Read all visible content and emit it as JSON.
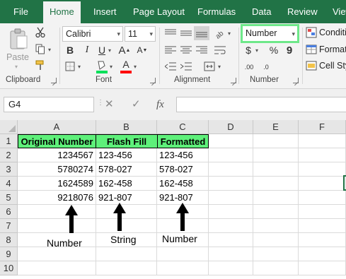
{
  "tabs": [
    {
      "label": "File",
      "active": false
    },
    {
      "label": "Home",
      "active": true
    },
    {
      "label": "Insert",
      "active": false
    },
    {
      "label": "Page Layout",
      "active": false
    },
    {
      "label": "Formulas",
      "active": false
    },
    {
      "label": "Data",
      "active": false
    },
    {
      "label": "Review",
      "active": false
    },
    {
      "label": "View",
      "active": false
    }
  ],
  "ribbon": {
    "clipboard": {
      "paste_label": "Paste",
      "group_label": "Clipboard"
    },
    "font": {
      "font_name": "Calibri",
      "font_size": "11",
      "group_label": "Font",
      "bold": "B",
      "italic": "I",
      "underline": "U",
      "grow": "A",
      "shrink": "A",
      "font_color": "A",
      "fill_color": "#ffff00",
      "font_color_value": "#ff0000"
    },
    "alignment": {
      "group_label": "Alignment"
    },
    "number": {
      "format": "Number",
      "group_label": "Number",
      "currency": "$",
      "percent": "%",
      "comma": "9",
      "inc_decimal": ".00",
      "dec_decimal": ".0"
    },
    "styles": {
      "conditional": "Conditi",
      "format_table": "Format",
      "cell_styles": "Cell Sty"
    }
  },
  "formula_bar": {
    "name_box": "G4",
    "cancel": "✕",
    "enter": "✓",
    "fx": "fx",
    "value": ""
  },
  "grid": {
    "columns": [
      "A",
      "B",
      "C",
      "D",
      "E",
      "F"
    ],
    "rows": [
      "1",
      "2",
      "3",
      "4",
      "5",
      "6",
      "7",
      "8",
      "9",
      "10"
    ],
    "header_row": [
      "Original Number",
      "Flash Fill",
      "Formatted"
    ],
    "data": [
      [
        "1234567",
        "123-456",
        "123-456"
      ],
      [
        "5780274",
        "578-027",
        "578-027"
      ],
      [
        "1624589",
        "162-458",
        "162-458"
      ],
      [
        "9218076",
        "921-807",
        "921-807"
      ]
    ],
    "header_fill": "#5ef07a"
  },
  "annotations": [
    "Number",
    "String",
    "Number"
  ]
}
